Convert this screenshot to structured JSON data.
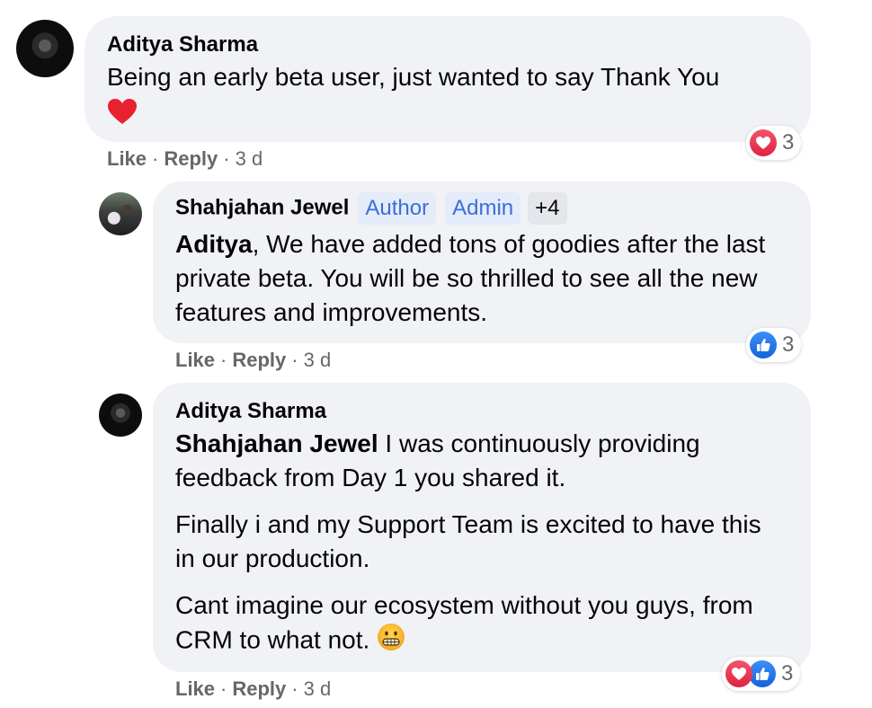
{
  "comments": [
    {
      "author": "Aditya Sharma",
      "text": "Being an early beta user, just wanted to say Thank You",
      "emoji": "red-heart",
      "actions": {
        "like": "Like",
        "reply": "Reply",
        "time": "3 d",
        "separator": "·"
      },
      "reactions": {
        "types": [
          "love"
        ],
        "count": "3"
      }
    },
    {
      "author": "Shahjahan Jewel",
      "badges": [
        "Author",
        "Admin",
        "+4"
      ],
      "mention": "Aditya",
      "text": ", We have added tons of goodies after the last private beta. You will be so thrilled to see all the new features and improvements.",
      "actions": {
        "like": "Like",
        "reply": "Reply",
        "time": "3 d",
        "separator": "·"
      },
      "reactions": {
        "types": [
          "like"
        ],
        "count": "3"
      }
    },
    {
      "author": "Aditya Sharma",
      "mention": "Shahjahan Jewel",
      "paragraphs": [
        " I was continuously providing feedback from Day 1 you shared it.",
        "Finally i and my Support Team is excited to have this in our production.",
        "Cant imagine our ecosystem without you guys, from CRM to what not."
      ],
      "emoji": "grimacing-face",
      "actions": {
        "like": "Like",
        "reply": "Reply",
        "time": "3 d",
        "separator": "·"
      },
      "reactions": {
        "types": [
          "love",
          "like"
        ],
        "count": "3"
      }
    }
  ],
  "colors": {
    "bubble": "#f0f2f5",
    "love": "#e0223f",
    "like": "#1463dd",
    "meta": "#65676b",
    "badge_text": "#3a6fd8"
  }
}
